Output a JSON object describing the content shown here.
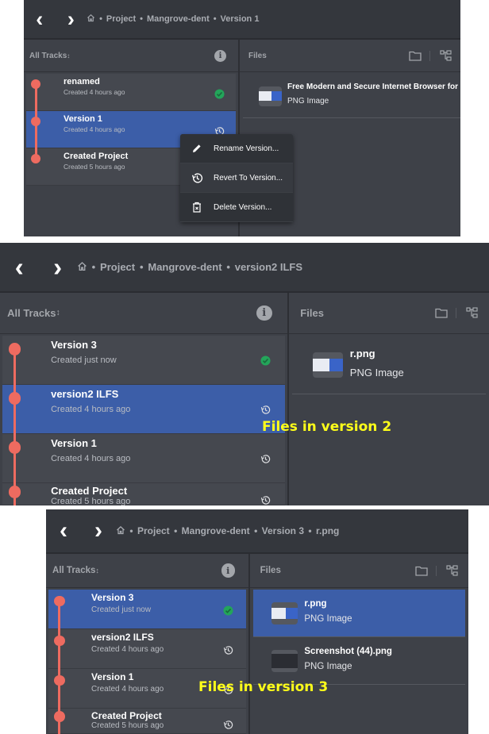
{
  "colors": {
    "accent": "#3c5ea8",
    "timeline": "#ee6b60",
    "current": "#23a55a"
  },
  "icons": {
    "back": "chevron-left-icon",
    "forward": "chevron-right-icon",
    "home": "home-icon",
    "info": "info-icon",
    "folder": "folder-icon",
    "tree": "tree-view-icon",
    "current": "check-circle-icon",
    "revert": "history-icon"
  },
  "common": {
    "tracks_label": "All Tracks",
    "files_label": "Files",
    "info_glyph": "i"
  },
  "panels": [
    {
      "breadcrumb": [
        "Project",
        "Mangrove-dent",
        "Version 1"
      ],
      "versions": [
        {
          "title": "renamed",
          "subtitle": "Created 4 hours ago",
          "status": "current"
        },
        {
          "title": "Version 1",
          "subtitle": "Created 4 hours ago",
          "status": "revert",
          "selected": true
        },
        {
          "title": "Created Project",
          "subtitle": "Created 5 hours ago",
          "status": "none"
        }
      ],
      "files": [
        {
          "name": "Free Modern and Secure Internet Browser for",
          "type": "PNG Image"
        }
      ],
      "context_menu": [
        {
          "label": "Rename Version...",
          "icon": "pencil-icon"
        },
        {
          "label": "Revert To Version...",
          "icon": "history-icon"
        },
        {
          "label": "Delete Version...",
          "icon": "trash-icon"
        }
      ]
    },
    {
      "breadcrumb": [
        "Project",
        "Mangrove-dent",
        "version2 ILFS"
      ],
      "versions": [
        {
          "title": "Version 3",
          "subtitle": "Created just now",
          "status": "current"
        },
        {
          "title": "version2 ILFS",
          "subtitle": "Created 4 hours ago",
          "status": "revert",
          "selected": true
        },
        {
          "title": "Version 1",
          "subtitle": "Created 4 hours ago",
          "status": "revert"
        },
        {
          "title": "Created Project",
          "subtitle": "Created 5 hours ago",
          "status": "revert"
        }
      ],
      "files": [
        {
          "name": "r.png",
          "type": "PNG Image"
        }
      ],
      "annotation": "Files in version 2"
    },
    {
      "breadcrumb": [
        "Project",
        "Mangrove-dent",
        "Version 3",
        "r.png"
      ],
      "versions": [
        {
          "title": "Version 3",
          "subtitle": "Created just now",
          "status": "current",
          "selected": true
        },
        {
          "title": "version2 ILFS",
          "subtitle": "Created 4 hours ago",
          "status": "revert"
        },
        {
          "title": "Version 1",
          "subtitle": "Created 4 hours ago",
          "status": "revert"
        },
        {
          "title": "Created Project",
          "subtitle": "Created 5 hours ago",
          "status": "revert"
        }
      ],
      "files": [
        {
          "name": "r.png",
          "type": "PNG Image",
          "selected": true
        },
        {
          "name": "Screenshot (44).png",
          "type": "PNG Image",
          "dark": true
        }
      ],
      "annotation": "Files in version 3"
    }
  ]
}
